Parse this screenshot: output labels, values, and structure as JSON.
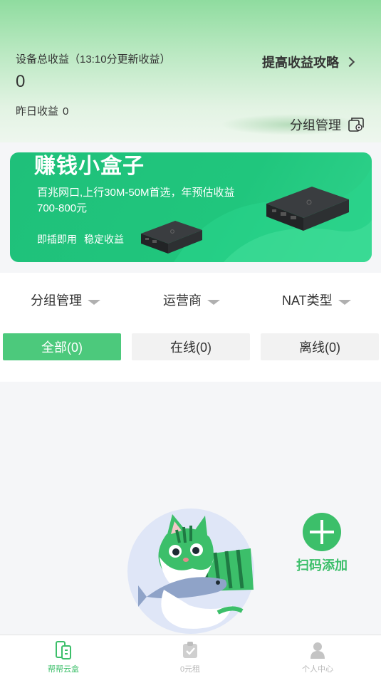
{
  "header": {
    "total_label": "设备总收益（13:10分更新收益）",
    "total_value": "0",
    "yesterday_label": "昨日收益",
    "yesterday_value": "0",
    "strategy_link": "提高收益攻略",
    "group_manage": "分组管理"
  },
  "banner": {
    "title": "赚钱小盒子",
    "desc": "百兆网口,上行30M-50M首选，年预估收益700-800元",
    "tag1": "即插即用",
    "tag2": "稳定收益"
  },
  "filters": {
    "dropdowns": [
      "分组管理",
      "运营商",
      "NAT类型"
    ],
    "segments": [
      "全部(0)",
      "在线(0)",
      "离线(0)"
    ]
  },
  "add": {
    "label": "扫码添加"
  },
  "tabbar": {
    "items": [
      "帮帮云盒",
      "0元租",
      "个人中心"
    ]
  },
  "colors": {
    "accent": "#3cbf6a",
    "segment_active": "#4cc97c",
    "banner": "#20c67d"
  },
  "icons": [
    "chevron-right-icon",
    "group-settings-icon",
    "dropdown-triangle-icon",
    "plus-icon",
    "cloud-box-tab-icon",
    "rent-tab-icon",
    "profile-tab-icon"
  ]
}
